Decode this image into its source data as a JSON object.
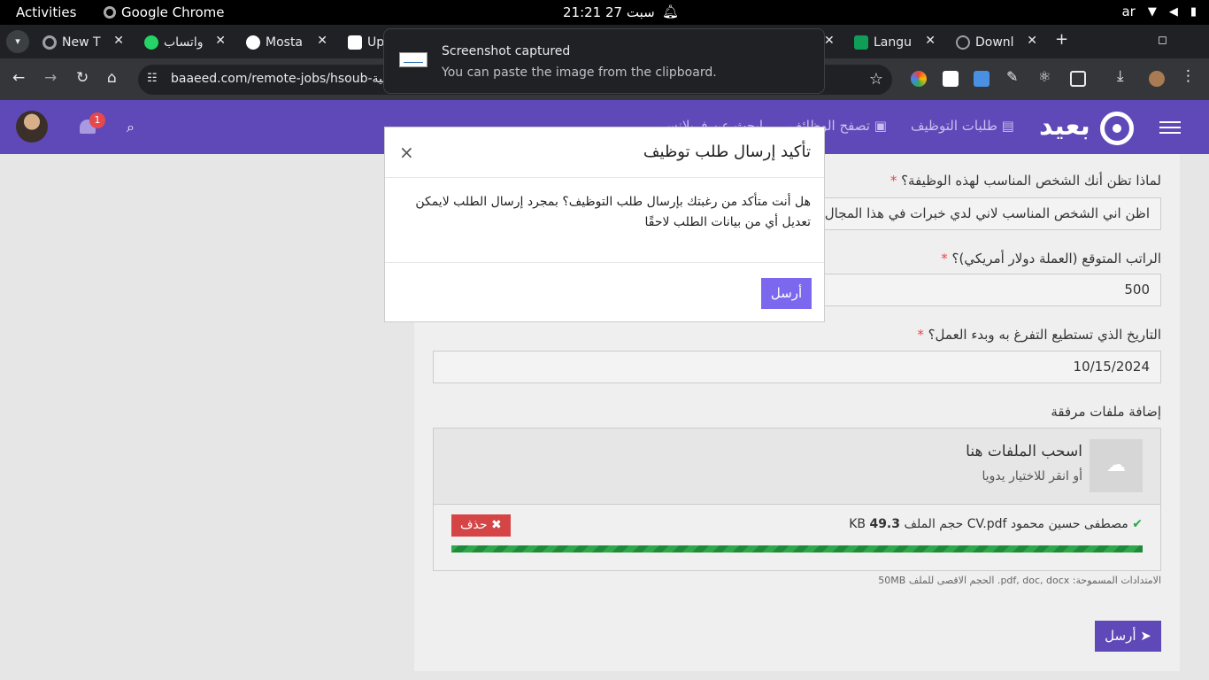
{
  "os": {
    "activities": "Activities",
    "app": "Google Chrome",
    "clock": "21:21  سبت 27",
    "lang": "ar"
  },
  "tabs": [
    {
      "label": "New T",
      "color": "#9aa0a6"
    },
    {
      "label": "واتساب",
      "color": "#25d366"
    },
    {
      "label": "Mosta",
      "color": "#ffffff"
    },
    {
      "label": "Up",
      "color": "#ffffff"
    },
    {
      "label": "Langu",
      "color": "#0f9d58"
    },
    {
      "label": "Downl",
      "color": "#9aa0a6"
    }
  ],
  "browser": {
    "url": "baaeed.com/remote-jobs/hsoub-أمامية",
    "new_tab": "+"
  },
  "toast": {
    "title": "Screenshot captured",
    "message": "You can paste the image from the clipboard."
  },
  "site": {
    "logo": "بعيد",
    "badge": "1",
    "menu": [
      "طلبات التوظيف",
      "تصفح الوظائف",
      "ابحث عن فريلانسر"
    ]
  },
  "form": {
    "q1": "لماذا تظن أنك الشخص المناسب لهذه الوظيفة؟",
    "q1_value": "اظن اني الشخص المناسب لاني لدي خبرات في هذا المجال  ولدي ت",
    "q2": "الراتب المتوقع (العملة دولار أمريكي)؟",
    "q2_value": "500",
    "q3": "التاريخ الذي تستطيع التفرغ به وبدء العمل؟",
    "q3_value": "10/15/2024",
    "attach_label": "إضافة ملفات مرفقة",
    "drop_title": "اسحب الملفات هنا",
    "drop_sub": "أو انقر للاختيار يدويا",
    "file_name": "مصطفى حسين محمود CV.pdf",
    "file_size_label": "حجم الملف",
    "file_size": "49.3",
    "file_unit": "KB",
    "delete": "حذف",
    "hint": "الامتدادات المسموحة: pdf, doc, docx. الحجم الاقصى للملف 50MB",
    "submit": "أرسل",
    "required": "*",
    "upload_progress": 1.0
  },
  "modal": {
    "title": "تأكيد إرسال طلب توظيف",
    "body": "هل أنت متأكد من رغبتك بإرسال طلب التوظيف؟ بمجرد إرسال الطلب لايمكن تعديل أي من بيانات الطلب لاحقًا",
    "send": "أرسل",
    "close": "×"
  }
}
